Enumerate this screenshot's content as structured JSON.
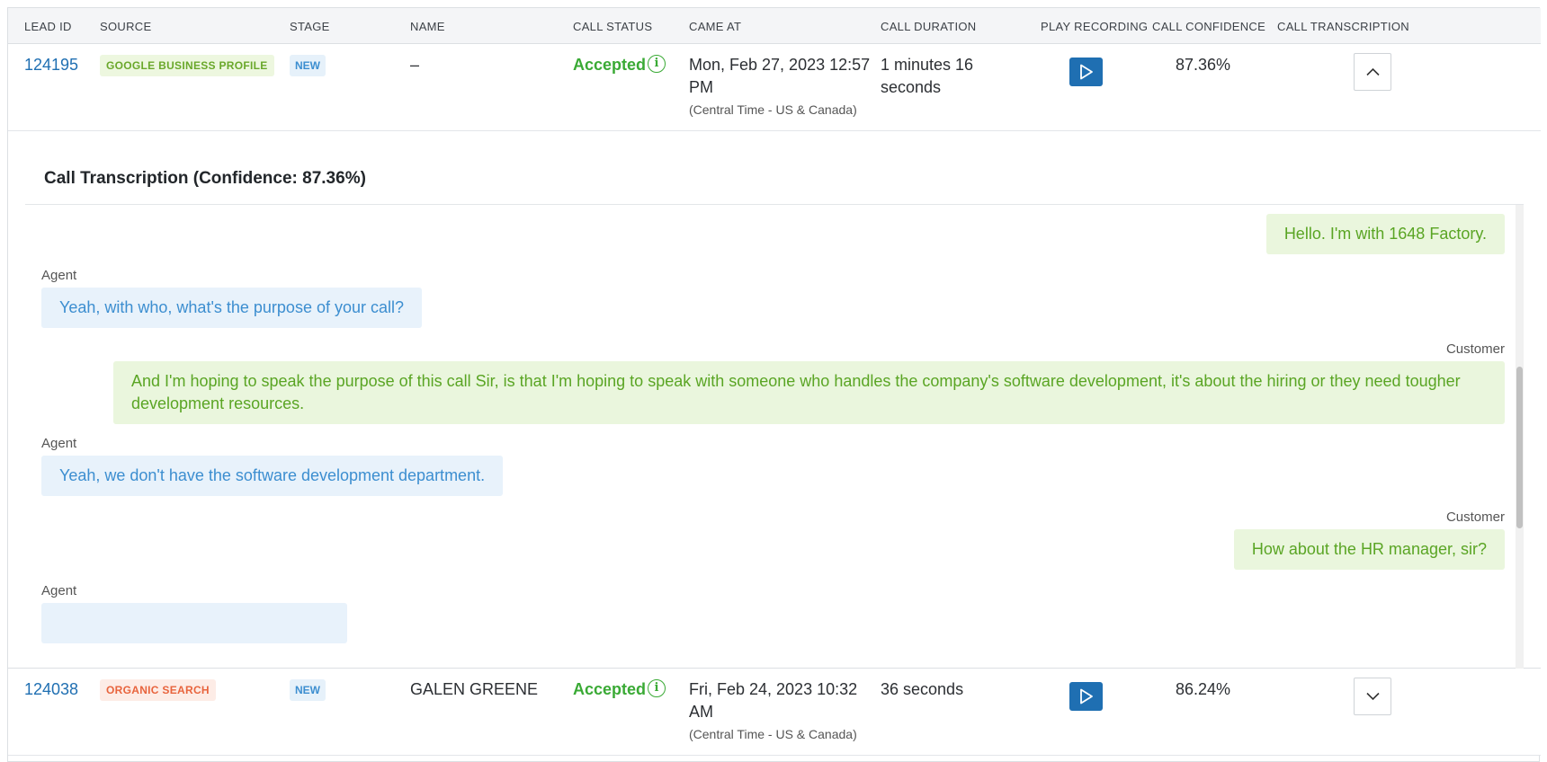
{
  "columns": {
    "lead_id": "LEAD ID",
    "source": "SOURCE",
    "stage": "STAGE",
    "name": "NAME",
    "call_status": "CALL STATUS",
    "came_at": "CAME AT",
    "call_duration": "CALL DURATION",
    "play_recording": "PLAY RECORDING",
    "call_confidence": "CALL CONFIDENCE",
    "call_transcription": "CALL TRANSCRIPTION"
  },
  "rows": [
    {
      "lead_id": "124195",
      "source": "GOOGLE BUSINESS PROFILE",
      "source_color": "#6aa82b",
      "stage": "NEW",
      "name": "–",
      "call_status": "Accepted",
      "came_at": "Mon, Feb 27, 2023 12:57 PM",
      "timezone": "(Central Time - US & Canada)",
      "duration": "1 minutes 16 seconds",
      "confidence": "87.36%",
      "expanded": true,
      "toggle_icon": "chevron-up-icon"
    },
    {
      "lead_id": "124038",
      "source": "ORGANIC SEARCH",
      "source_color": "#e8643d",
      "stage": "NEW",
      "name": "GALEN GREENE",
      "call_status": "Accepted",
      "came_at": "Fri, Feb 24, 2023 10:32 AM",
      "timezone": "(Central Time - US & Canada)",
      "duration": "36 seconds",
      "confidence": "86.24%",
      "expanded": false,
      "toggle_icon": "chevron-down-icon"
    }
  ],
  "transcription": {
    "title": "Call Transcription (Confidence: 87.36%)",
    "messages": [
      {
        "speaker": "",
        "role": "customer",
        "text": "Hello. I'm with 1648 Factory."
      },
      {
        "speaker": "Agent",
        "role": "agent",
        "text": "Yeah, with who, what's the purpose of your call?"
      },
      {
        "speaker": "Customer",
        "role": "customer",
        "text": "And I'm hoping to speak the purpose of this call Sir, is that I'm hoping to speak with someone who handles the company's software development, it's about the hiring or they need tougher development resources."
      },
      {
        "speaker": "Agent",
        "role": "agent",
        "text": "Yeah, we don't have the software development department."
      },
      {
        "speaker": "Customer",
        "role": "customer",
        "text": "How about the HR manager, sir?"
      },
      {
        "speaker": "Agent",
        "role": "agent",
        "text": ""
      }
    ]
  },
  "colors": {
    "link": "#1f6fb2",
    "accepted": "#3aaa35",
    "agent_bubble": "#e8f2fb",
    "customer_bubble": "#eaf6dd"
  }
}
